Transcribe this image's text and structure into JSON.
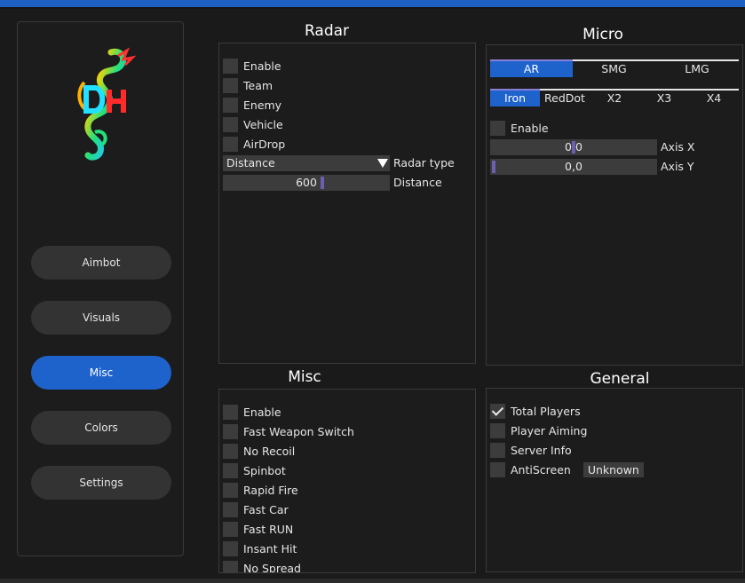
{
  "sidebar": {
    "logo_icon": "dragon-logo-icon",
    "nav": [
      {
        "label": "Aimbot",
        "active": false
      },
      {
        "label": "Visuals",
        "active": false
      },
      {
        "label": "Misc",
        "active": true
      },
      {
        "label": "Colors",
        "active": false
      },
      {
        "label": "Settings",
        "active": false
      }
    ]
  },
  "radar": {
    "title": "Radar",
    "options": [
      {
        "label": "Enable",
        "checked": false
      },
      {
        "label": "Team",
        "checked": false
      },
      {
        "label": "Enemy",
        "checked": false
      },
      {
        "label": "Vehicle",
        "checked": false
      },
      {
        "label": "AirDrop",
        "checked": false
      }
    ],
    "radar_type": {
      "value": "Distance",
      "label": "Radar type"
    },
    "distance": {
      "value": "600",
      "label": "Distance",
      "fraction": 0.6
    }
  },
  "micro": {
    "title": "Micro",
    "weapon_tabs": [
      {
        "label": "AR",
        "active": true
      },
      {
        "label": "SMG",
        "active": false
      },
      {
        "label": "LMG",
        "active": false
      }
    ],
    "scope_tabs": [
      {
        "label": "Iron",
        "active": true
      },
      {
        "label": "RedDot",
        "active": false
      },
      {
        "label": "X2",
        "active": false
      },
      {
        "label": "X3",
        "active": false
      },
      {
        "label": "X4",
        "active": false
      }
    ],
    "enable_label": "Enable",
    "axis_x": {
      "value": "0,0",
      "label": "Axis X"
    },
    "axis_y": {
      "value": "0,0",
      "label": "Axis Y"
    }
  },
  "misc": {
    "title": "Misc",
    "options": [
      {
        "label": "Enable",
        "checked": false
      },
      {
        "label": "Fast Weapon Switch",
        "checked": false
      },
      {
        "label": "No Recoil",
        "checked": false
      },
      {
        "label": "Spinbot",
        "checked": false
      },
      {
        "label": "Rapid Fire",
        "checked": false
      },
      {
        "label": "Fast Car",
        "checked": false
      },
      {
        "label": "Fast RUN",
        "checked": false
      },
      {
        "label": "Insant Hit",
        "checked": false
      },
      {
        "label": "No Spread",
        "checked": false
      }
    ]
  },
  "general": {
    "title": "General",
    "options": [
      {
        "label": "Total Players",
        "checked": true
      },
      {
        "label": "Player Aiming",
        "checked": false
      },
      {
        "label": "Server Info",
        "checked": false
      },
      {
        "label": "AntiScreen",
        "checked": false
      }
    ],
    "antiscreen_status": "Unknown"
  },
  "colors": {
    "accent": "#1e63cc",
    "background": "#1a1a1a",
    "control": "#3c3c3c",
    "slider_grab": "#6a5fb0"
  }
}
